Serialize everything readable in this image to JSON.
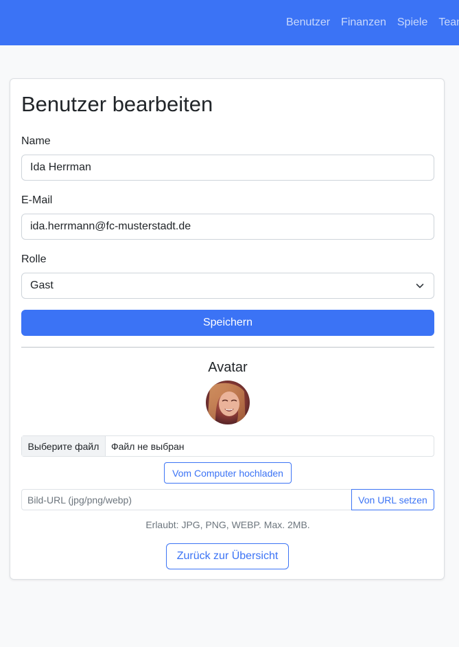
{
  "nav": {
    "items": [
      {
        "label": "Benutzer"
      },
      {
        "label": "Finanzen"
      },
      {
        "label": "Spiele"
      },
      {
        "label": "Team"
      }
    ]
  },
  "form": {
    "title": "Benutzer bearbeiten",
    "name_label": "Name",
    "name_value": "Ida Herrman",
    "email_label": "E-Mail",
    "email_value": "ida.herrmann@fc-musterstadt.de",
    "role_label": "Rolle",
    "role_value": "Gast",
    "save_label": "Speichern"
  },
  "avatar": {
    "heading": "Avatar",
    "file_button_label": "Выберите файл",
    "file_status": "Файл не выбран",
    "upload_button_label": "Vom Computer hochladen",
    "url_placeholder": "Bild-URL (jpg/png/webp)",
    "url_button_label": "Von URL setzen",
    "hint": "Erlaubt: JPG, PNG, WEBP. Max. 2MB."
  },
  "back_button_label": "Zurück zur Übersicht",
  "colors": {
    "primary": "#3b73f5",
    "page_background": "#f8f9fa"
  },
  "icons": {
    "select_arrow": "chevron-down-icon"
  }
}
